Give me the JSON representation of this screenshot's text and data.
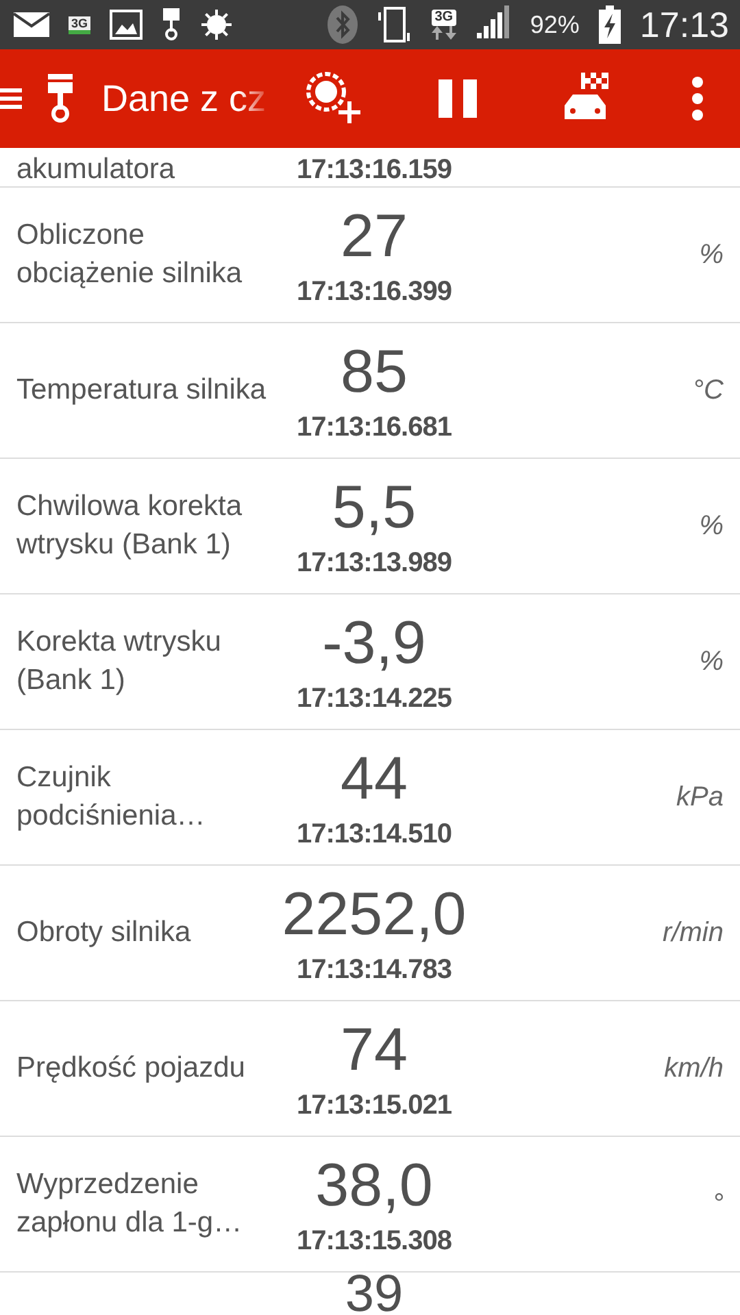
{
  "status_bar": {
    "notification_badge": "3G",
    "network_label": "3G",
    "battery": "92%",
    "time": "17:13"
  },
  "toolbar": {
    "title": "Dane z cz"
  },
  "readings": [
    {
      "label": "akumulatora",
      "time": "17:13:16.159"
    },
    {
      "label": "Obliczone obciążenie silnika",
      "value": "27",
      "time": "17:13:16.399",
      "unit": "%"
    },
    {
      "label": "Temperatura silnika",
      "value": "85",
      "time": "17:13:16.681",
      "unit": "°C"
    },
    {
      "label": "Chwilowa korekta wtrysku (Bank 1)",
      "value": "5,5",
      "time": "17:13:13.989",
      "unit": "%"
    },
    {
      "label": "Korekta wtrysku (Bank 1)",
      "value": "-3,9",
      "time": "17:13:14.225",
      "unit": "%"
    },
    {
      "label": "Czujnik podciśnienia…",
      "value": "44",
      "time": "17:13:14.510",
      "unit": "kPa"
    },
    {
      "label": "Obroty silnika",
      "value": "2252,0",
      "time": "17:13:14.783",
      "unit": "r/min"
    },
    {
      "label": "Prędkość pojazdu",
      "value": "74",
      "time": "17:13:15.021",
      "unit": "km/h"
    },
    {
      "label": "Wyprzedzenie zapłonu dla 1-g…",
      "value": "38,0",
      "time": "17:13:15.308",
      "unit": "°"
    },
    {
      "value": "39"
    }
  ]
}
